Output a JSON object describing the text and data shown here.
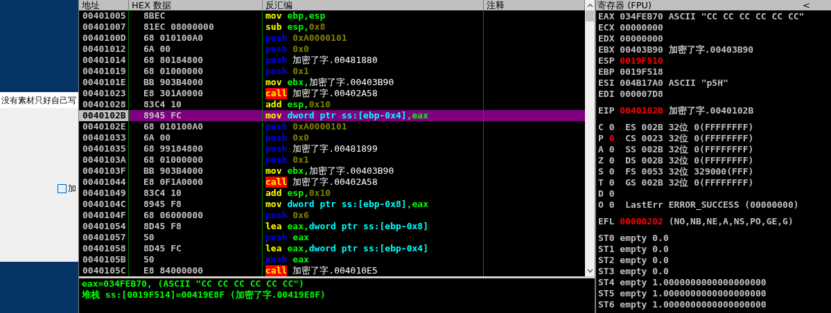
{
  "desktop": {
    "window_caption": "没有素材只好自己写",
    "checkbox": {
      "label": "加",
      "checked": false
    }
  },
  "disassembly": {
    "columns": [
      "地址",
      "HEX 数据",
      "反汇编",
      "注释"
    ],
    "rows": [
      {
        "address": "00401005",
        "hex": "8BEC",
        "mnemonic": "mov",
        "kind": "general",
        "selected": false,
        "operands": [
          {
            "text": "ebp,esp",
            "kind": "reg"
          }
        ]
      },
      {
        "address": "00401007",
        "hex": "81EC 08000000",
        "mnemonic": "sub",
        "kind": "general",
        "selected": false,
        "operands": [
          {
            "text": "esp,",
            "kind": "reg"
          },
          {
            "text": "0x8",
            "kind": "const"
          }
        ]
      },
      {
        "address": "0040100D",
        "hex": "68 010100A0",
        "mnemonic": "push",
        "kind": "stack",
        "selected": false,
        "operands": [
          {
            "text": "0xA0000101",
            "kind": "const"
          }
        ]
      },
      {
        "address": "00401012",
        "hex": "6A 00",
        "mnemonic": "push",
        "kind": "stack",
        "selected": false,
        "operands": [
          {
            "text": "0x0",
            "kind": "const"
          }
        ]
      },
      {
        "address": "00401014",
        "hex": "68 80184800",
        "mnemonic": "push",
        "kind": "stack",
        "selected": false,
        "operands": [
          {
            "text": "加密了字.00481880",
            "kind": "sym"
          }
        ]
      },
      {
        "address": "00401019",
        "hex": "68 01000000",
        "mnemonic": "push",
        "kind": "stack",
        "selected": false,
        "operands": [
          {
            "text": "0x1",
            "kind": "const"
          }
        ]
      },
      {
        "address": "0040101E",
        "hex": "BB 903B4000",
        "mnemonic": "mov",
        "kind": "general",
        "selected": false,
        "operands": [
          {
            "text": "ebx,",
            "kind": "reg"
          },
          {
            "text": "加密了字.00403B90",
            "kind": "sym"
          }
        ]
      },
      {
        "address": "00401023",
        "hex": "E8 301A0000",
        "mnemonic": "call",
        "kind": "call",
        "selected": false,
        "operands": [
          {
            "text": "加密了字.00402A58",
            "kind": "sym"
          }
        ]
      },
      {
        "address": "00401028",
        "hex": "83C4 10",
        "mnemonic": "add",
        "kind": "general",
        "selected": false,
        "operands": [
          {
            "text": "esp,",
            "kind": "reg"
          },
          {
            "text": "0x10",
            "kind": "const"
          }
        ]
      },
      {
        "address": "0040102B",
        "hex": "8945 FC",
        "mnemonic": "mov",
        "kind": "general",
        "selected": true,
        "operands": [
          {
            "text": "dword ptr ss:[ebp-0x4]",
            "kind": "mem"
          },
          {
            "text": ",eax",
            "kind": "reg"
          }
        ]
      },
      {
        "address": "0040102E",
        "hex": "68 010100A0",
        "mnemonic": "push",
        "kind": "stack",
        "selected": false,
        "operands": [
          {
            "text": "0xA0000101",
            "kind": "const"
          }
        ]
      },
      {
        "address": "00401033",
        "hex": "6A 00",
        "mnemonic": "push",
        "kind": "stack",
        "selected": false,
        "operands": [
          {
            "text": "0x0",
            "kind": "const"
          }
        ]
      },
      {
        "address": "00401035",
        "hex": "68 99184800",
        "mnemonic": "push",
        "kind": "stack",
        "selected": false,
        "operands": [
          {
            "text": "加密了字.00481899",
            "kind": "sym"
          }
        ]
      },
      {
        "address": "0040103A",
        "hex": "68 01000000",
        "mnemonic": "push",
        "kind": "stack",
        "selected": false,
        "operands": [
          {
            "text": "0x1",
            "kind": "const"
          }
        ]
      },
      {
        "address": "0040103F",
        "hex": "BB 903B4000",
        "mnemonic": "mov",
        "kind": "general",
        "selected": false,
        "operands": [
          {
            "text": "ebx,",
            "kind": "reg"
          },
          {
            "text": "加密了字.00403B90",
            "kind": "sym"
          }
        ]
      },
      {
        "address": "00401044",
        "hex": "E8 0F1A0000",
        "mnemonic": "call",
        "kind": "call",
        "selected": false,
        "operands": [
          {
            "text": "加密了字.00402A58",
            "kind": "sym"
          }
        ]
      },
      {
        "address": "00401049",
        "hex": "83C4 10",
        "mnemonic": "add",
        "kind": "general",
        "selected": false,
        "operands": [
          {
            "text": "esp,",
            "kind": "reg"
          },
          {
            "text": "0x10",
            "kind": "const"
          }
        ]
      },
      {
        "address": "0040104C",
        "hex": "8945 F8",
        "mnemonic": "mov",
        "kind": "general",
        "selected": false,
        "operands": [
          {
            "text": "dword ptr ss:[ebp-0x8]",
            "kind": "mem"
          },
          {
            "text": ",eax",
            "kind": "reg"
          }
        ]
      },
      {
        "address": "0040104F",
        "hex": "68 06000000",
        "mnemonic": "push",
        "kind": "stack",
        "selected": false,
        "operands": [
          {
            "text": "0x6",
            "kind": "const"
          }
        ]
      },
      {
        "address": "00401054",
        "hex": "8D45 F8",
        "mnemonic": "lea",
        "kind": "general",
        "selected": false,
        "operands": [
          {
            "text": "eax,",
            "kind": "reg"
          },
          {
            "text": "dword ptr ss:[ebp-0x8]",
            "kind": "mem"
          }
        ]
      },
      {
        "address": "00401057",
        "hex": "50",
        "mnemonic": "push",
        "kind": "stack",
        "selected": false,
        "operands": [
          {
            "text": "eax",
            "kind": "reg"
          }
        ]
      },
      {
        "address": "00401058",
        "hex": "8D45 FC",
        "mnemonic": "lea",
        "kind": "general",
        "selected": false,
        "operands": [
          {
            "text": "eax,",
            "kind": "reg"
          },
          {
            "text": "dword ptr ss:[ebp-0x4]",
            "kind": "mem"
          }
        ]
      },
      {
        "address": "0040105B",
        "hex": "50",
        "mnemonic": "push",
        "kind": "stack",
        "selected": false,
        "operands": [
          {
            "text": "eax",
            "kind": "reg"
          }
        ]
      },
      {
        "address": "0040105C",
        "hex": "E8 84000000",
        "mnemonic": "call",
        "kind": "call",
        "selected": false,
        "operands": [
          {
            "text": "加密了字.004010E5",
            "kind": "sym"
          }
        ]
      }
    ],
    "info_lines": [
      "eax=034FEB70, (ASCII \"CC CC CC CC CC CC\")",
      "堆栈 ss:[0019F514]=00419E8F (加密了字.00419E8F)"
    ]
  },
  "registers": {
    "title": "寄存器 (FPU)",
    "collapse_glyph": "<",
    "groups": [
      [
        [
          {
            "text": "EAX 034FEB70 ASCII \"CC CC CC CC CC CC\"",
            "changed": false
          }
        ],
        [
          {
            "text": "ECX 00000000",
            "changed": false
          }
        ],
        [
          {
            "text": "EDX 00000000",
            "changed": false
          }
        ],
        [
          {
            "text": "EBX 00403B90 加密了字.00403B90",
            "changed": false
          }
        ],
        [
          {
            "text": "ESP ",
            "changed": false
          },
          {
            "text": "0019F510",
            "changed": true
          }
        ],
        [
          {
            "text": "EBP 0019F518",
            "changed": false
          }
        ],
        [
          {
            "text": "ESI 004B17A0 ASCII \"p5H\"",
            "changed": false
          }
        ],
        [
          {
            "text": "EDI 000007D8",
            "changed": false
          }
        ]
      ],
      [
        [
          {
            "text": "EIP ",
            "changed": false
          },
          {
            "text": "0040102B",
            "changed": true
          },
          {
            "text": " 加密了字.0040102B",
            "changed": false
          }
        ]
      ],
      [
        [
          {
            "text": "C 0  ES 002B 32位 0(FFFFFFFF)",
            "changed": false
          }
        ],
        [
          {
            "text": "P ",
            "changed": false
          },
          {
            "text": "0",
            "changed": true
          },
          {
            "text": "  CS 0023 32位 0(FFFFFFFF)",
            "changed": false
          }
        ],
        [
          {
            "text": "A 0  SS 002B 32位 0(FFFFFFFF)",
            "changed": false
          }
        ],
        [
          {
            "text": "Z 0  DS 002B 32位 0(FFFFFFFF)",
            "changed": false
          }
        ],
        [
          {
            "text": "S 0  FS 0053 32位 329000(FFF)",
            "changed": false
          }
        ],
        [
          {
            "text": "T 0  GS 002B 32位 0(FFFFFFFF)",
            "changed": false
          }
        ],
        [
          {
            "text": "D 0",
            "changed": false
          }
        ],
        [
          {
            "text": "O 0  LastErr ERROR_SUCCESS (00000000)",
            "changed": false
          }
        ]
      ],
      [
        [
          {
            "text": "EFL ",
            "changed": false
          },
          {
            "text": "00000202",
            "changed": true
          },
          {
            "text": " (NO,NB,NE,A,NS,PO,GE,G)",
            "changed": false
          }
        ]
      ],
      [
        [
          {
            "text": "ST0 empty 0.0",
            "changed": false
          }
        ],
        [
          {
            "text": "ST1 empty 0.0",
            "changed": false
          }
        ],
        [
          {
            "text": "ST2 empty 0.0",
            "changed": false
          }
        ],
        [
          {
            "text": "ST3 empty 0.0",
            "changed": false
          }
        ],
        [
          {
            "text": "ST4 empty 1.0000000000000000000",
            "changed": false
          }
        ],
        [
          {
            "text": "ST5 empty 1.0000000000000000000",
            "changed": false
          }
        ],
        [
          {
            "text": "ST6 empty 1.0000000000000000000",
            "changed": false
          }
        ]
      ]
    ]
  }
}
